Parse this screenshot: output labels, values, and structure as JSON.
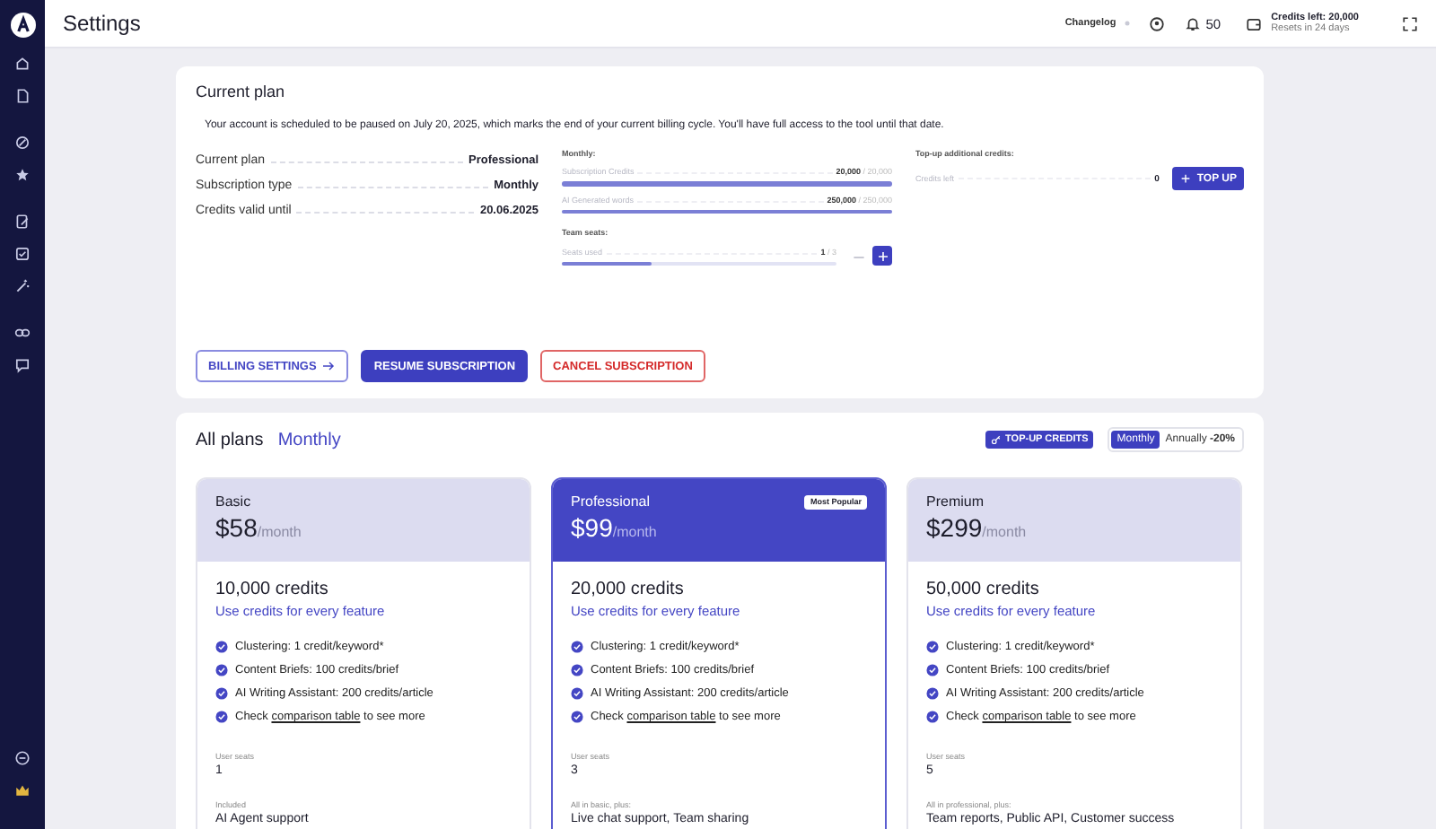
{
  "header": {
    "title": "Settings",
    "changelog": "Changelog",
    "notifications": "50",
    "credits": "Credits left: 20,000",
    "resets": "Resets in 24 days"
  },
  "current_plan": {
    "title": "Current plan",
    "notice": "Your account is scheduled to be paused on July 20, 2025, which marks the end of your current billing cycle. You'll have full access to the tool until that date.",
    "details": [
      {
        "label": "Current plan",
        "value": "Professional"
      },
      {
        "label": "Subscription type",
        "value": "Monthly"
      },
      {
        "label": "Credits valid until",
        "value": "20.06.2025"
      }
    ],
    "monthly": {
      "title": "Monthly:",
      "meters": [
        {
          "label": "Subscription Credits",
          "used": "20,000",
          "total": "/ 20,000",
          "level": 1.0
        },
        {
          "label": "AI Generated words",
          "used": "250,000",
          "total": "/ 250,000",
          "level": 1.0
        }
      ]
    },
    "team_seats": {
      "title": "Team seats:",
      "label": "Seats used",
      "used": "1",
      "total": "/ 3",
      "level": 0.33
    },
    "topup": {
      "title": "Top-up additional credits:",
      "label": "Credits left",
      "value": "0",
      "button": "TOP UP"
    },
    "buttons": [
      {
        "label": "BILLING SETTINGS",
        "kind": "outline"
      },
      {
        "label": "RESUME SUBSCRIPTION",
        "kind": "primary"
      },
      {
        "label": "CANCEL SUBSCRIPTION",
        "kind": "danger"
      }
    ]
  },
  "all_plans": {
    "title": "All plans",
    "period": "Monthly",
    "topup_button": "TOP-UP CREDITS",
    "billing_toggle": [
      {
        "label": "Monthly",
        "selected": true
      },
      {
        "label": "Annually **-20%**",
        "selected": false
      }
    ],
    "plans": [
      {
        "name": "Basic",
        "price": "$58",
        "per": "/month",
        "featured": false,
        "credits": "10,000 credits",
        "credits_link": "Use credits for every feature",
        "features": [
          {
            "kind": "text",
            "text": "Clustering: 1 credit/keyword*"
          },
          {
            "kind": "text",
            "text": "Content Briefs: 100 credits/brief"
          },
          {
            "kind": "text",
            "text": "AI Writing Assistant: 200 credits/article"
          },
          {
            "kind": "link",
            "before": "Check",
            "link": "comparison table",
            "after": "to see more"
          }
        ],
        "seats_label": "User seats",
        "seats": "1",
        "included_label": "Included",
        "included": "AI Agent support"
      },
      {
        "name": "Professional",
        "price": "$99",
        "per": "/month",
        "featured": true,
        "badge": "Most Popular",
        "credits": "20,000 credits",
        "credits_link": "Use credits for every feature",
        "features": [
          {
            "kind": "text",
            "text": "Clustering: 1 credit/keyword*"
          },
          {
            "kind": "text",
            "text": "Content Briefs: 100 credits/brief"
          },
          {
            "kind": "text",
            "text": "AI Writing Assistant: 200 credits/article"
          },
          {
            "kind": "link",
            "before": "Check",
            "link": "comparison table",
            "after": "to see more"
          }
        ],
        "seats_label": "User seats",
        "seats": "3",
        "included_label": "All in basic, plus:",
        "included": "Live chat support, Team sharing"
      },
      {
        "name": "Premium",
        "price": "$299",
        "per": "/month",
        "featured": false,
        "credits": "50,000 credits",
        "credits_link": "Use credits for every feature",
        "features": [
          {
            "kind": "text",
            "text": "Clustering: 1 credit/keyword*"
          },
          {
            "kind": "text",
            "text": "Content Briefs: 100 credits/brief"
          },
          {
            "kind": "text",
            "text": "AI Writing Assistant: 200 credits/article"
          },
          {
            "kind": "link",
            "before": "Check",
            "link": "comparison table",
            "after": "to see more"
          }
        ],
        "seats_label": "User seats",
        "seats": "5",
        "included_label": "All in professional, plus:",
        "included": "Team reports, Public API, Customer success"
      }
    ]
  }
}
